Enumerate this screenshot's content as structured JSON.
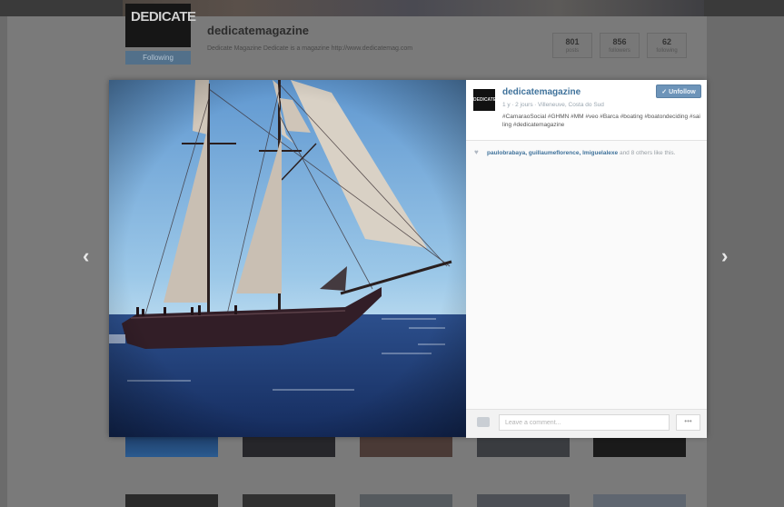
{
  "background": {
    "logo_text": "DEDICATE",
    "follow_label": "Following",
    "username": "dedicatemagazine",
    "bio": "Dedicate Magazine  Dedicate is a magazine  http://www.dedicatemag.com",
    "stats": [
      {
        "value": "801",
        "label": "posts"
      },
      {
        "value": "856",
        "label": "followers"
      },
      {
        "value": "62",
        "label": "following"
      }
    ]
  },
  "modal": {
    "avatar_text": "DEDICATE",
    "username": "dedicatemagazine",
    "unfollow_label": "Unfollow",
    "meta": "1 y ∙ 2 jours ∙ Villeneuve, Costa do Sud",
    "caption": "#CamaraoSocial #GHMN #MM #veo #Barca #boating #boatondeciding #sailing #dedicatemagazine",
    "likes_names": "paulobrabaya, guillaumeflorence, lmiguelalexe",
    "likes_rest": "and 8 others like this.",
    "comment_placeholder": "Leave a comment...",
    "more_label": "•••"
  },
  "nav": {
    "prev": "‹",
    "next": "›"
  },
  "icons": {
    "heart": "heart-icon",
    "comment": "comment-bubble-icon"
  },
  "colors": {
    "username_blue": "#3f729b",
    "unfollow_button": "#6d94b9"
  }
}
